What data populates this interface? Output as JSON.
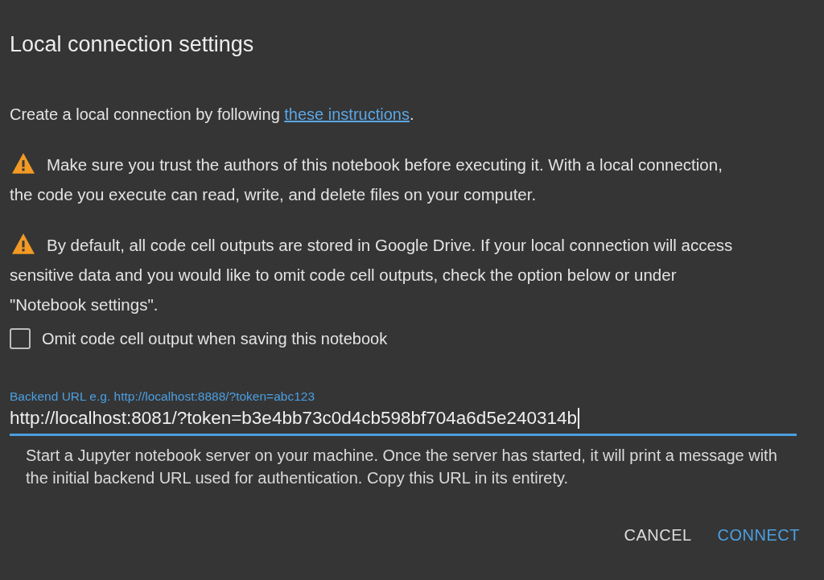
{
  "dialog": {
    "title": "Local connection settings",
    "intro": {
      "before": "Create a local connection by following ",
      "link": "these instructions",
      "after": "."
    },
    "warnings": [
      "Make sure you trust the authors of this notebook before executing it. With a local connection, the code you execute can read, write, and delete files on your computer.",
      "By default, all code cell outputs are stored in Google Drive. If your local connection will access sensitive data and you would like to omit code cell outputs, check the option below or under \"Notebook settings\"."
    ],
    "omit_option": {
      "label": "Omit code cell output when saving this notebook",
      "checked": false
    },
    "backend_url": {
      "label": "Backend URL e.g. http://localhost:8888/?token=abc123",
      "value": "http://localhost:8081/?token=b3e4bb73c0d4cb598bf704a6d5e240314b",
      "focused": true
    },
    "help": "Start a Jupyter notebook server on your machine. Once the server has started, it will print a message with the initial backend URL used for authentication. Copy this URL in its entirety.",
    "buttons": [
      {
        "label": "CANCEL",
        "kind": "secondary"
      },
      {
        "label": "CONNECT",
        "kind": "primary"
      }
    ]
  }
}
